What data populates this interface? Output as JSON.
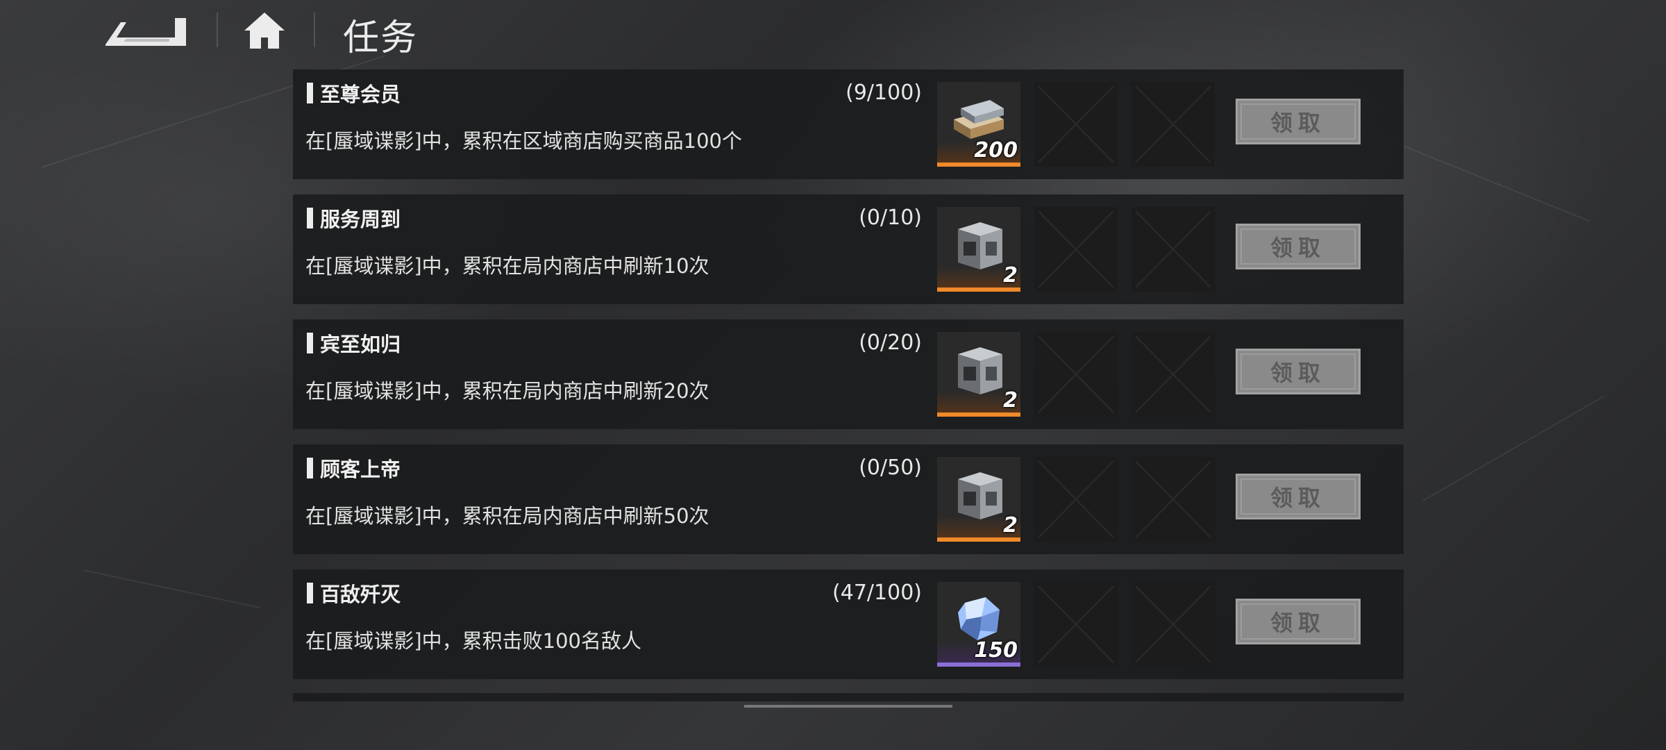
{
  "header": {
    "title": "任务",
    "back_icon": "back-arrow-icon",
    "home_icon": "home-icon"
  },
  "tasks": [
    {
      "name": "至尊会员",
      "progress": "(9/100)",
      "description": "在[蜃域谍影]中，累积在区域商店购买商品100个",
      "reward": {
        "icon": "gold-bars-icon",
        "count": "200",
        "rarity_color": "#f08a2a"
      },
      "claim_label": "领取"
    },
    {
      "name": "服务周到",
      "progress": "(0/10)",
      "description": "在[蜃域谍影]中，累积在局内商店中刷新10次",
      "reward": {
        "icon": "supply-crate-icon",
        "count": "2",
        "rarity_color": "#f08a2a"
      },
      "claim_label": "领取"
    },
    {
      "name": "宾至如归",
      "progress": "(0/20)",
      "description": "在[蜃域谍影]中，累积在局内商店中刷新20次",
      "reward": {
        "icon": "supply-crate-icon",
        "count": "2",
        "rarity_color": "#f08a2a"
      },
      "claim_label": "领取"
    },
    {
      "name": "顾客上帝",
      "progress": "(0/50)",
      "description": "在[蜃域谍影]中，累积在局内商店中刷新50次",
      "reward": {
        "icon": "supply-crate-icon",
        "count": "2",
        "rarity_color": "#f08a2a"
      },
      "claim_label": "领取"
    },
    {
      "name": "百敌歼灭",
      "progress": "(47/100)",
      "description": "在[蜃域谍影]中，累积击败100名敌人",
      "reward": {
        "icon": "crystal-ore-icon",
        "count": "150",
        "rarity_color": "#8a6fd8"
      },
      "claim_label": "领取"
    }
  ]
}
